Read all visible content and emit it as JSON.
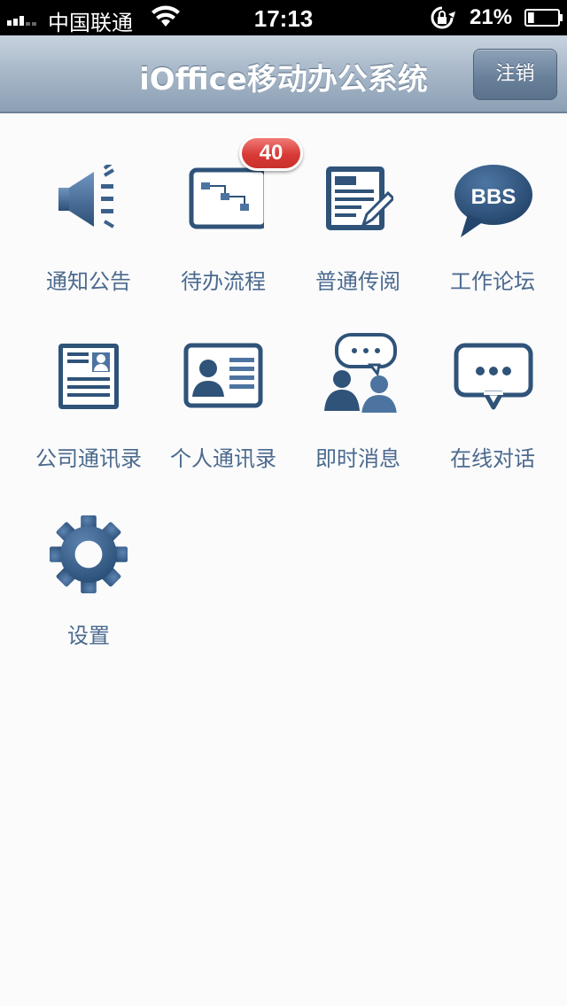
{
  "status_bar": {
    "carrier": "中国联通",
    "time": "17:13",
    "battery_percent": "21%",
    "battery_level": 0.21
  },
  "nav": {
    "title": "iOffice移动办公系统",
    "logout_label": "注销"
  },
  "menu": {
    "items": [
      {
        "label": "通知公告",
        "icon": "speaker-icon"
      },
      {
        "label": "待办流程",
        "icon": "workflow-icon",
        "badge": "40"
      },
      {
        "label": "普通传阅",
        "icon": "document-edit-icon"
      },
      {
        "label": "工作论坛",
        "icon": "bbs-bubble-icon",
        "icon_text": "BBS"
      },
      {
        "label": "公司通讯录",
        "icon": "company-contacts-icon"
      },
      {
        "label": "个人通讯录",
        "icon": "personal-card-icon"
      },
      {
        "label": "即时消息",
        "icon": "instant-message-icon"
      },
      {
        "label": "在线对话",
        "icon": "chat-bubble-icon"
      },
      {
        "label": "设置",
        "icon": "gear-icon"
      }
    ]
  },
  "colors": {
    "icon_dark": "#2f5379",
    "icon_light": "#5f87b3",
    "label": "#4b6a8e",
    "badge": "#d83a36"
  }
}
